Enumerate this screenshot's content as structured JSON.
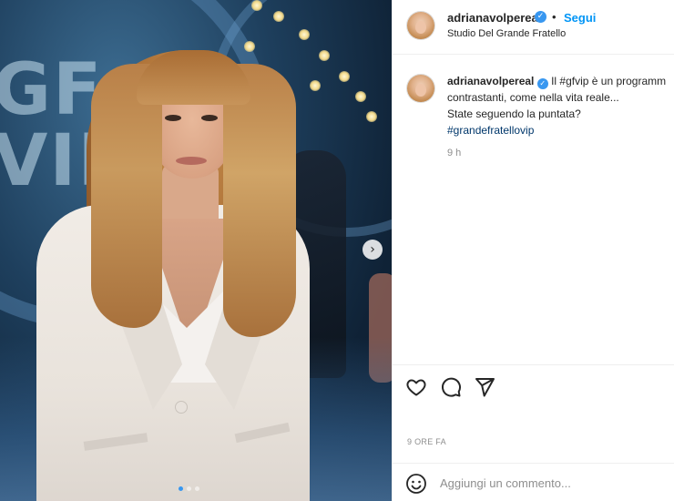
{
  "post": {
    "username": "adrianavolpereal",
    "follow_label": "Segui",
    "separator": "•",
    "location": "Studio Del Grande Fratello",
    "logo_text": "GF VIP"
  },
  "caption": {
    "username": "adrianavolpereal",
    "line1": "Il #gfvip è un programm",
    "line2": "contrastanti, come nella vita reale...",
    "line3": "State seguendo la puntata?",
    "hashtag": "#grandefratellovip",
    "time": "9 h"
  },
  "actions": {
    "like_icon": "heart-icon",
    "comment_icon": "comment-icon",
    "share_icon": "paper-plane-icon"
  },
  "post_date": "9 ORE FA",
  "comment_box": {
    "placeholder": "Aggiungi un commento...",
    "emoji_icon": "smiley-icon"
  },
  "carousel": {
    "next_glyph": "›",
    "slides_count": 3,
    "active_index": 0
  },
  "colors": {
    "accent": "#0095f6",
    "verified": "#3897f0",
    "hashtag": "#00376b",
    "muted": "#8e8e8e"
  }
}
